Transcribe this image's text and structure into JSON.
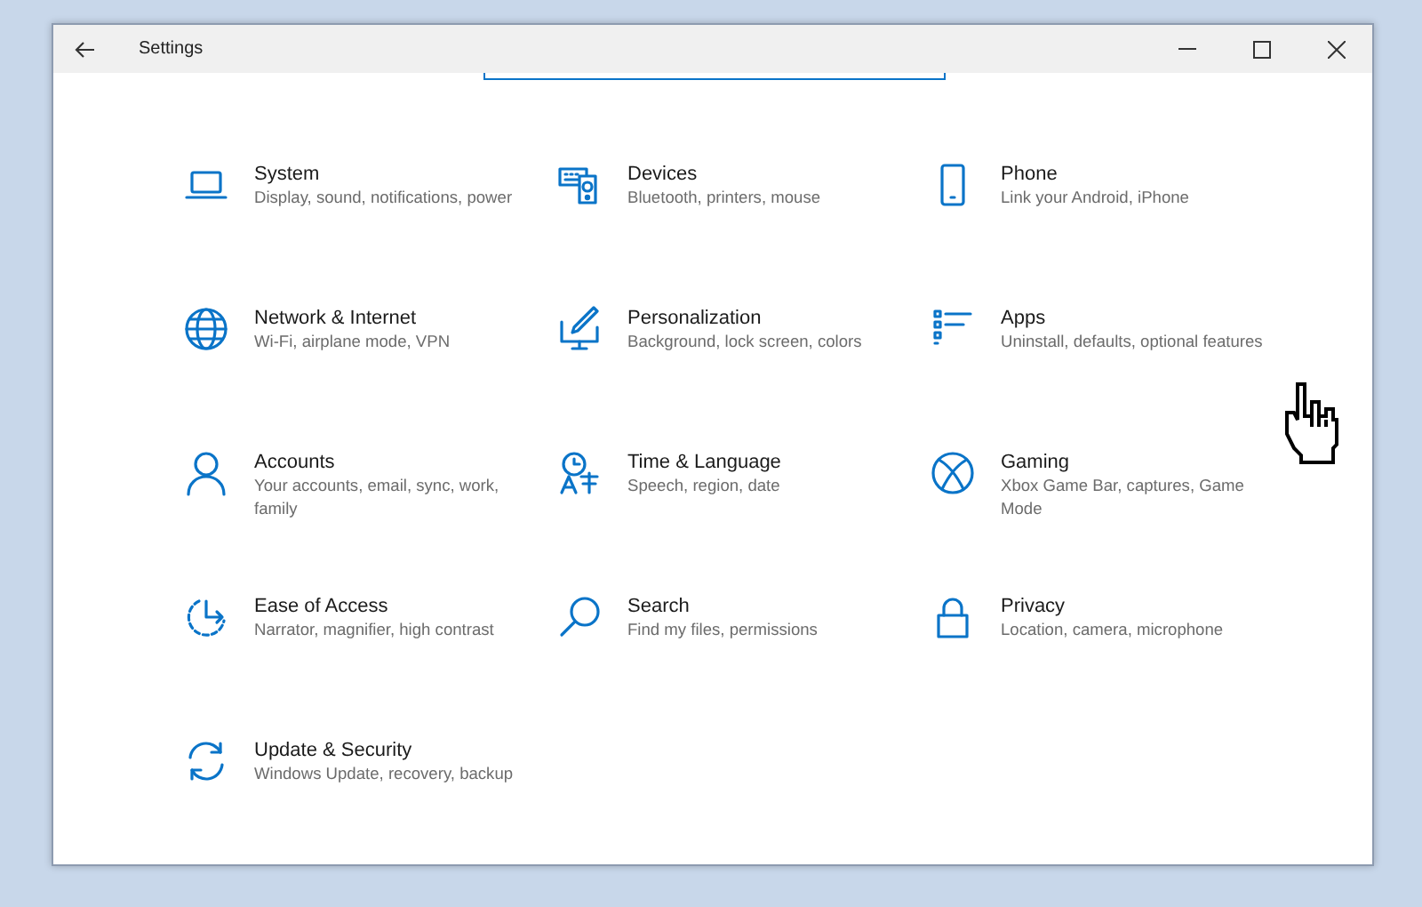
{
  "window": {
    "title": "Settings"
  },
  "categories": [
    {
      "title": "System",
      "description": "Display, sound, notifications, power"
    },
    {
      "title": "Devices",
      "description": "Bluetooth, printers, mouse"
    },
    {
      "title": "Phone",
      "description": "Link your Android, iPhone"
    },
    {
      "title": "Network & Internet",
      "description": "Wi-Fi, airplane mode, VPN"
    },
    {
      "title": "Personalization",
      "description": "Background, lock screen, colors"
    },
    {
      "title": "Apps",
      "description": "Uninstall, defaults, optional features"
    },
    {
      "title": "Accounts",
      "description": "Your accounts, email, sync, work, family"
    },
    {
      "title": "Time & Language",
      "description": "Speech, region, date"
    },
    {
      "title": "Gaming",
      "description": "Xbox Game Bar, captures, Game Mode"
    },
    {
      "title": "Ease of Access",
      "description": "Narrator, magnifier, high contrast"
    },
    {
      "title": "Search",
      "description": "Find my files, permissions"
    },
    {
      "title": "Privacy",
      "description": "Location, camera, microphone"
    },
    {
      "title": "Update & Security",
      "description": "Windows Update, recovery, backup"
    }
  ]
}
